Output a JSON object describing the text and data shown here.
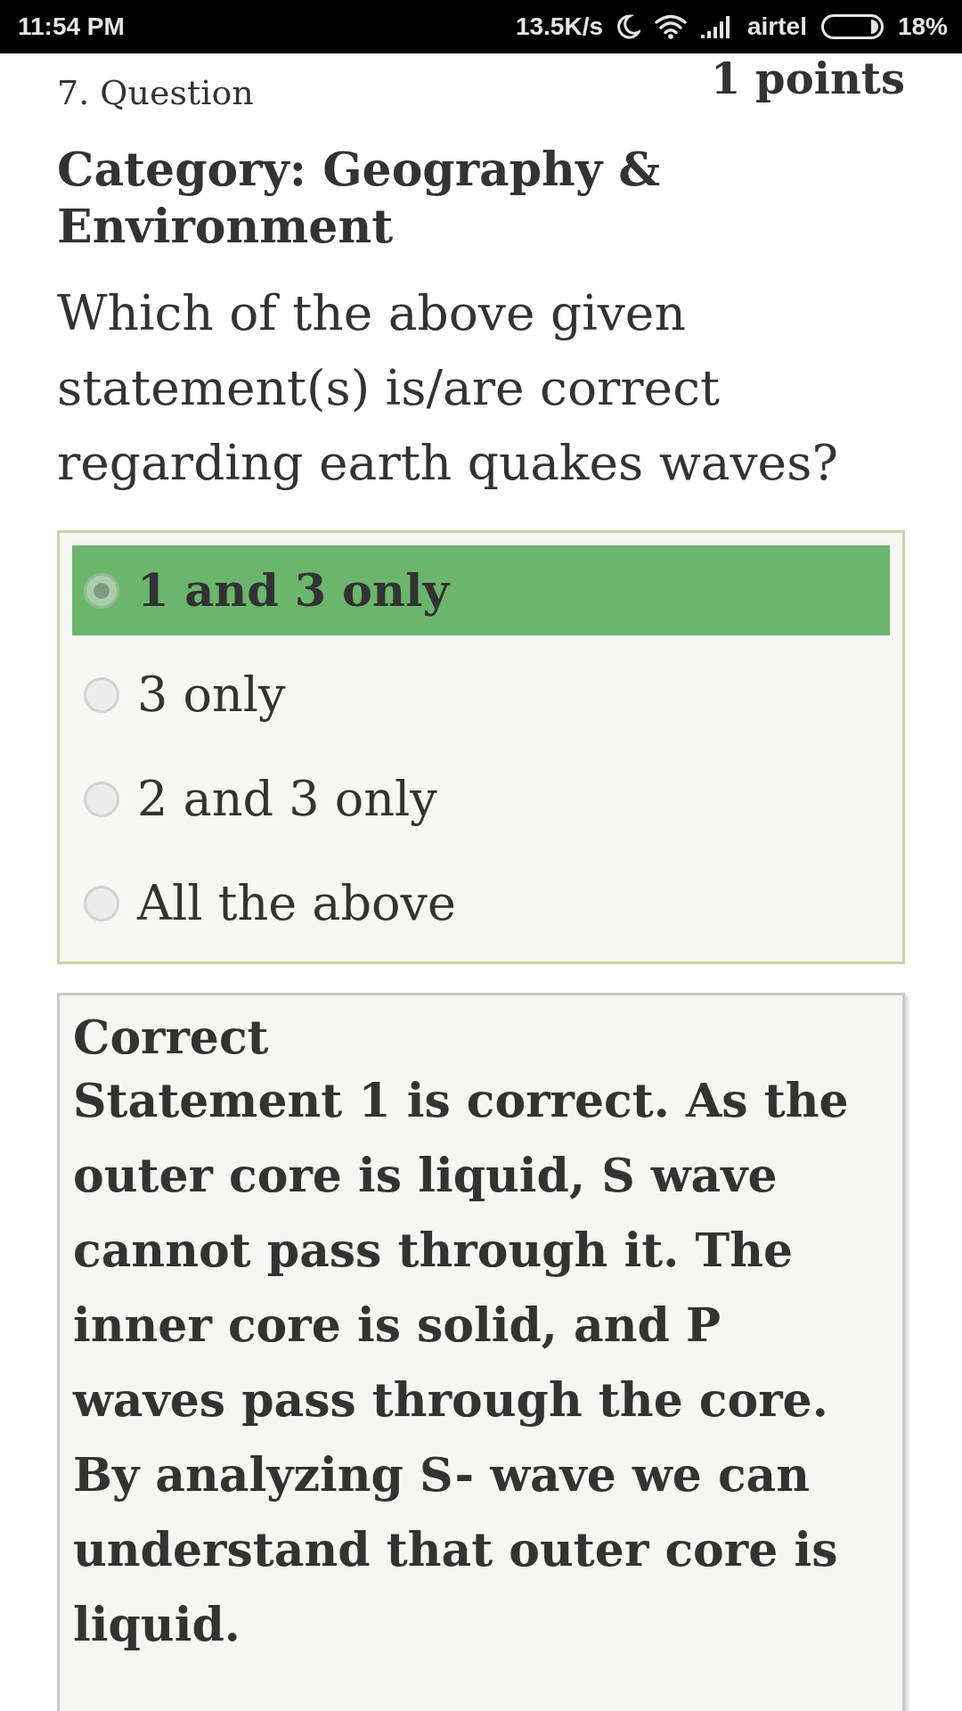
{
  "status_bar": {
    "time": "11:54 PM",
    "network_speed": "13.5K/s",
    "carrier": "airtel",
    "battery": "18%"
  },
  "question": {
    "number_label": "7. Question",
    "points": "1 points",
    "category": "Category: Geography & Environment",
    "text": "Which of the above given statement(s) is/are correct regarding earth quakes waves?"
  },
  "options": [
    {
      "label": "1 and 3 only",
      "selected": true
    },
    {
      "label": "3 only",
      "selected": false
    },
    {
      "label": "2 and 3 only",
      "selected": false
    },
    {
      "label": "All the above",
      "selected": false
    }
  ],
  "feedback": {
    "title": "Correct",
    "text": "Statement 1 is correct. As the outer core is liquid, S wave cannot pass through it. The inner core is solid, and P waves pass through the core. By analyzing S- wave we can understand that outer core is liquid."
  }
}
